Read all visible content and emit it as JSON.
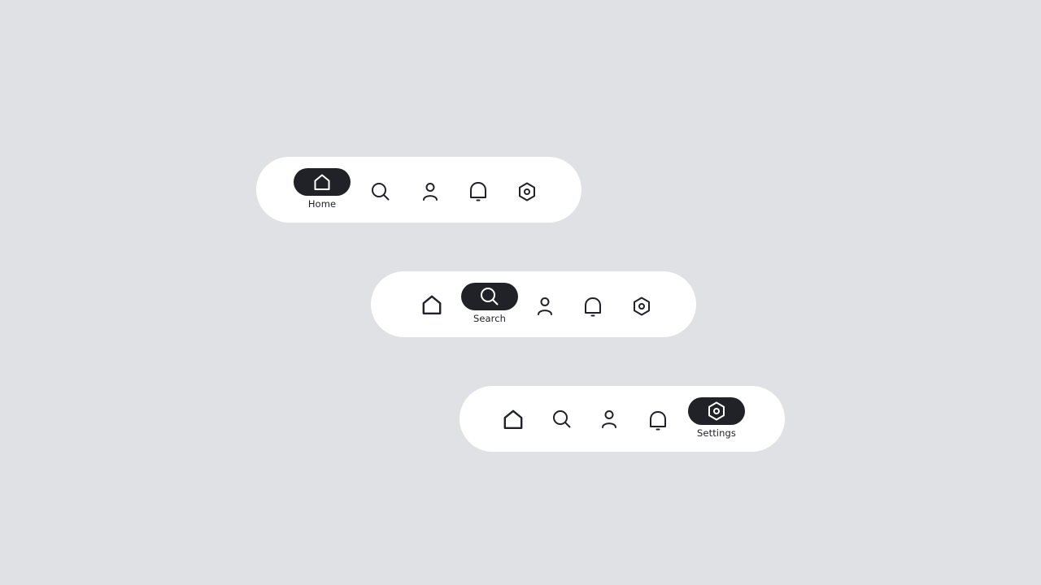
{
  "navbars": [
    {
      "active": "home",
      "items": [
        {
          "id": "home",
          "icon": "home-icon",
          "label": "Home"
        },
        {
          "id": "search",
          "icon": "search-icon"
        },
        {
          "id": "profile",
          "icon": "user-icon"
        },
        {
          "id": "notifications",
          "icon": "bell-icon"
        },
        {
          "id": "settings",
          "icon": "settings-icon"
        }
      ]
    },
    {
      "active": "search",
      "items": [
        {
          "id": "home",
          "icon": "home-icon"
        },
        {
          "id": "search",
          "icon": "search-icon",
          "label": "Search"
        },
        {
          "id": "profile",
          "icon": "user-icon"
        },
        {
          "id": "notifications",
          "icon": "bell-icon"
        },
        {
          "id": "settings",
          "icon": "settings-icon"
        }
      ]
    },
    {
      "active": "settings",
      "items": [
        {
          "id": "home",
          "icon": "home-icon"
        },
        {
          "id": "search",
          "icon": "search-icon"
        },
        {
          "id": "profile",
          "icon": "user-icon"
        },
        {
          "id": "notifications",
          "icon": "bell-icon"
        },
        {
          "id": "settings",
          "icon": "settings-icon",
          "label": "Settings"
        }
      ]
    }
  ],
  "colors": {
    "background": "#e0e1e4",
    "bar": "#ffffff",
    "active_pill": "#202227",
    "icon": "#202227",
    "active_icon": "#ffffff"
  }
}
